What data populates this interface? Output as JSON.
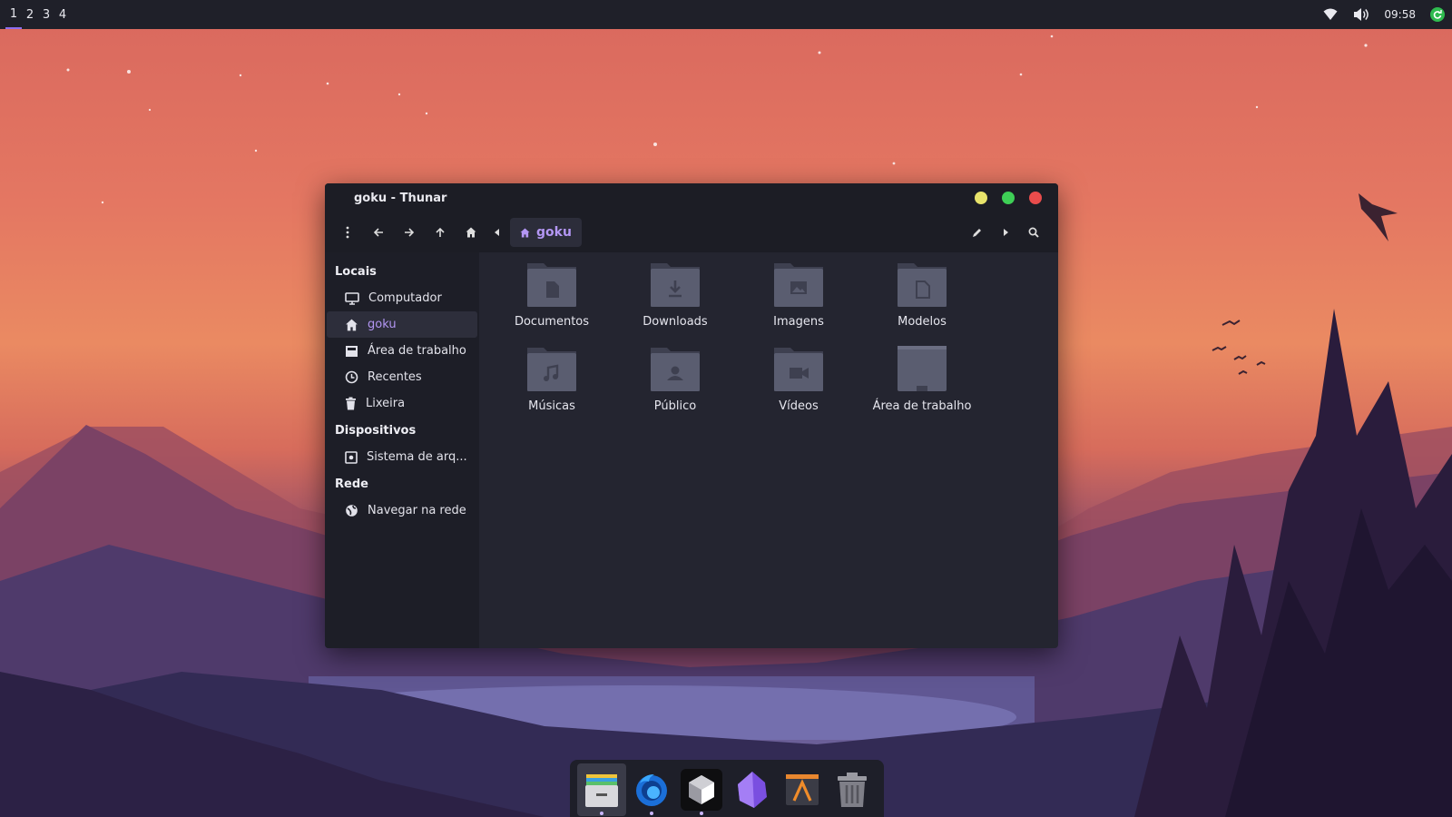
{
  "topbar": {
    "workspaces": [
      "1",
      "2",
      "3",
      "4"
    ],
    "active_workspace": "1",
    "clock": "09:58",
    "tray_icons": [
      "wifi-icon",
      "volume-icon",
      "update-icon"
    ]
  },
  "window": {
    "title": "goku - Thunar",
    "controls": {
      "minimize_color": "#e8e36b",
      "maximize_color": "#3ecf56",
      "close_color": "#e94c4c"
    },
    "breadcrumb": "goku"
  },
  "sidebar": {
    "sections": [
      {
        "title": "Locais",
        "items": [
          {
            "label": "Computador",
            "icon": "monitor-icon"
          },
          {
            "label": "goku",
            "icon": "home-icon",
            "selected": true
          },
          {
            "label": "Área de trabalho",
            "icon": "desktop-icon"
          },
          {
            "label": "Recentes",
            "icon": "clock-icon"
          },
          {
            "label": "Lixeira",
            "icon": "trash-icon"
          }
        ]
      },
      {
        "title": "Dispositivos",
        "items": [
          {
            "label": "Sistema de arq...",
            "icon": "drive-icon"
          }
        ]
      },
      {
        "title": "Rede",
        "items": [
          {
            "label": "Navegar na rede",
            "icon": "globe-icon"
          }
        ]
      }
    ]
  },
  "files": [
    {
      "label": "Documentos",
      "icon": "folder-documents-icon"
    },
    {
      "label": "Downloads",
      "icon": "folder-download-icon"
    },
    {
      "label": "Imagens",
      "icon": "folder-pictures-icon"
    },
    {
      "label": "Modelos",
      "icon": "folder-templates-icon"
    },
    {
      "label": "Músicas",
      "icon": "folder-music-icon"
    },
    {
      "label": "Público",
      "icon": "folder-public-icon"
    },
    {
      "label": "Vídeos",
      "icon": "folder-videos-icon"
    },
    {
      "label": "Área de trabalho",
      "icon": "folder-desktop-icon"
    }
  ],
  "dock": {
    "apps": [
      {
        "name": "files-app-icon",
        "running": true,
        "focused": true
      },
      {
        "name": "firefox-app-icon",
        "running": true
      },
      {
        "name": "unity-app-icon",
        "running": true
      },
      {
        "name": "obsidian-app-icon",
        "running": false
      },
      {
        "name": "sublime-app-icon",
        "running": false
      },
      {
        "name": "trash-app-icon",
        "running": false
      }
    ]
  },
  "colors": {
    "accent": "#b396f3",
    "window_bg": "#242530",
    "sidebar_bg": "#1d1e27",
    "folder": "#5a5d70"
  }
}
